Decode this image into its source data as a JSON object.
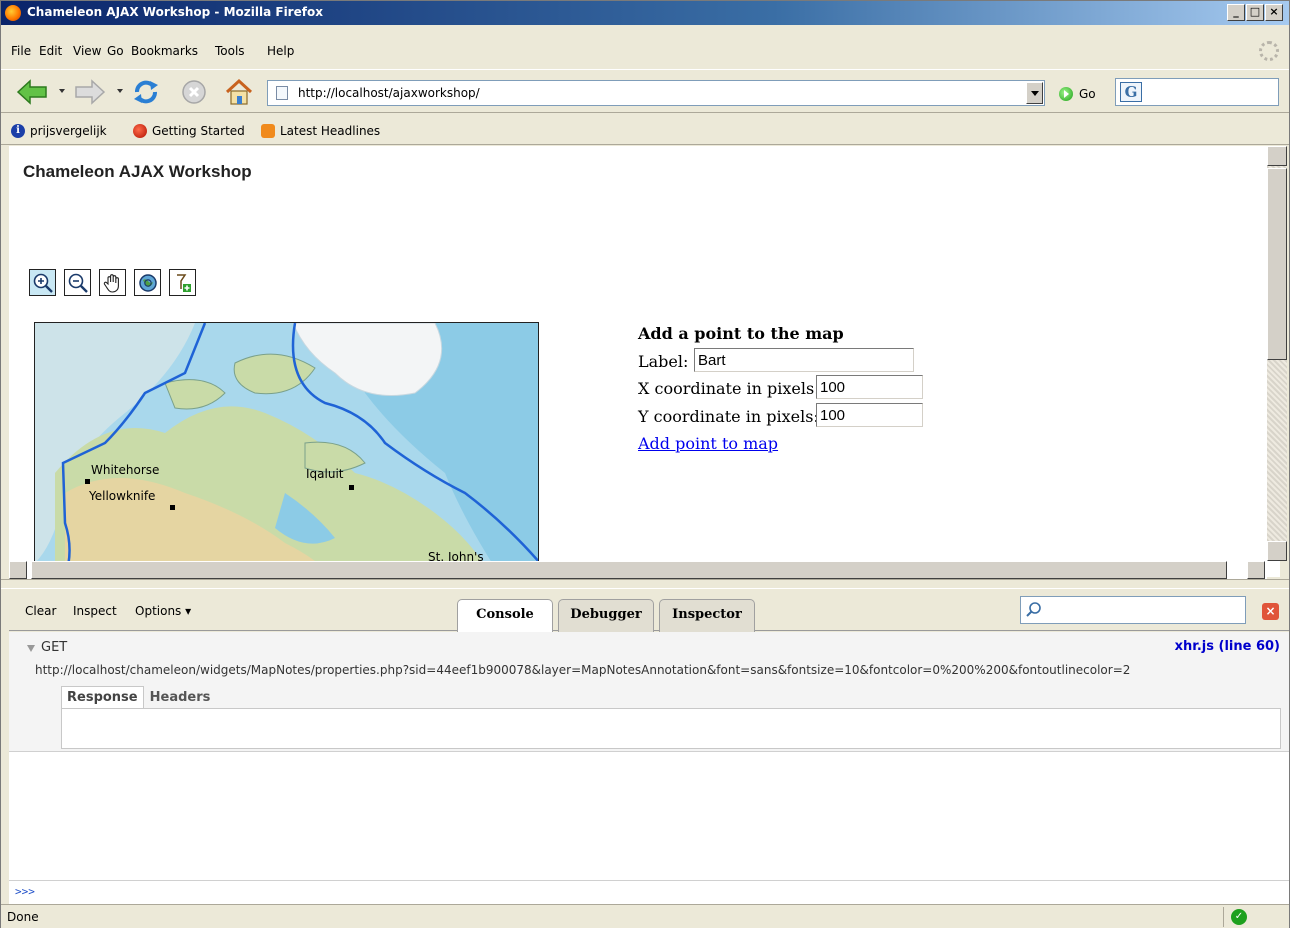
{
  "window": {
    "title": "Chameleon AJAX Workshop - Mozilla Firefox"
  },
  "menu": {
    "items": [
      "File",
      "Edit",
      "View",
      "Go",
      "Bookmarks",
      "Tools",
      "Help"
    ]
  },
  "navigation": {
    "url": "http://localhost/ajaxworkshop/",
    "go_label": "Go",
    "search_engine_icon": "google-icon"
  },
  "bookmarks": [
    {
      "label": "prijsvergelijk",
      "icon": "info-icon"
    },
    {
      "label": "Getting Started",
      "icon": "firefox-red-icon"
    },
    {
      "label": "Latest Headlines",
      "icon": "rss-icon"
    }
  ],
  "page": {
    "title": "Chameleon AJAX Workshop",
    "tools": [
      "zoom-in-icon",
      "zoom-out-icon",
      "pan-hand-icon",
      "zoom-extent-icon",
      "add-point-icon"
    ],
    "map": {
      "places": [
        "Whitehorse",
        "Yellowknife",
        "Iqaluit",
        "St. John's"
      ]
    },
    "form": {
      "heading": "Add a point to the map",
      "label_text": "Label:",
      "label_value": "Bart",
      "x_text": "X coordinate in pixels:",
      "x_value": "100",
      "y_text": "Y coordinate in pixels:",
      "y_value": "100",
      "submit_link": "Add point to map"
    }
  },
  "firebug": {
    "toolbar": {
      "clear": "Clear",
      "inspect": "Inspect",
      "options": "Options"
    },
    "tabs": [
      "Console",
      "Debugger",
      "Inspector"
    ],
    "selected_tab": "Console",
    "request": {
      "method": "GET",
      "source": "xhr.js (line 60)",
      "url": "http://localhost/chameleon/widgets/MapNotes/properties.php?sid=44eef1b900078&layer=MapNotesAnnotation&font=sans&fontsize=10&fontcolor=0%200%200&fontoutlinecolor=2",
      "subtabs": [
        "Response",
        "Headers"
      ]
    },
    "prompt": ">>>"
  },
  "status": {
    "text": "Done"
  },
  "colors": {
    "titlebar_start": "#0a246a",
    "titlebar_end": "#a6caf0",
    "link": "#0000ee",
    "firebug_source": "#0000cc"
  }
}
